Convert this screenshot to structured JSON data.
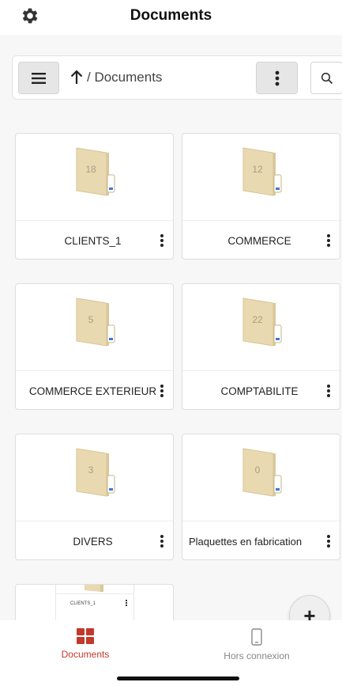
{
  "header": {
    "title": "Documents",
    "settings_icon": "gear-icon"
  },
  "toolbar": {
    "menu_icon": "hamburger-icon",
    "up_icon": "arrow-up-icon",
    "breadcrumb": "/ Documents",
    "more_icon": "vertical-dots-icon",
    "search_icon": "search-icon"
  },
  "folders": [
    {
      "name": "CLIENTS_1",
      "count": "18"
    },
    {
      "name": "COMMERCE",
      "count": "12"
    },
    {
      "name": "COMMERCE EXTERIEUR",
      "count": "5"
    },
    {
      "name": "COMPTABILITE",
      "count": "22"
    },
    {
      "name": "DIVERS",
      "count": "3"
    },
    {
      "name": "Plaquettes en fabrication",
      "count": "0"
    }
  ],
  "partial_card": {
    "name": "CLIENTS_1"
  },
  "fab": {
    "label": "+"
  },
  "bottom_nav": {
    "items": [
      {
        "label": "Documents",
        "icon": "grid-icon",
        "active": true
      },
      {
        "label": "Hors connexion",
        "icon": "phone-icon",
        "active": false
      }
    ]
  },
  "colors": {
    "accent": "#c0392b",
    "folder": "#e8d9b0",
    "inactive": "#888888"
  }
}
